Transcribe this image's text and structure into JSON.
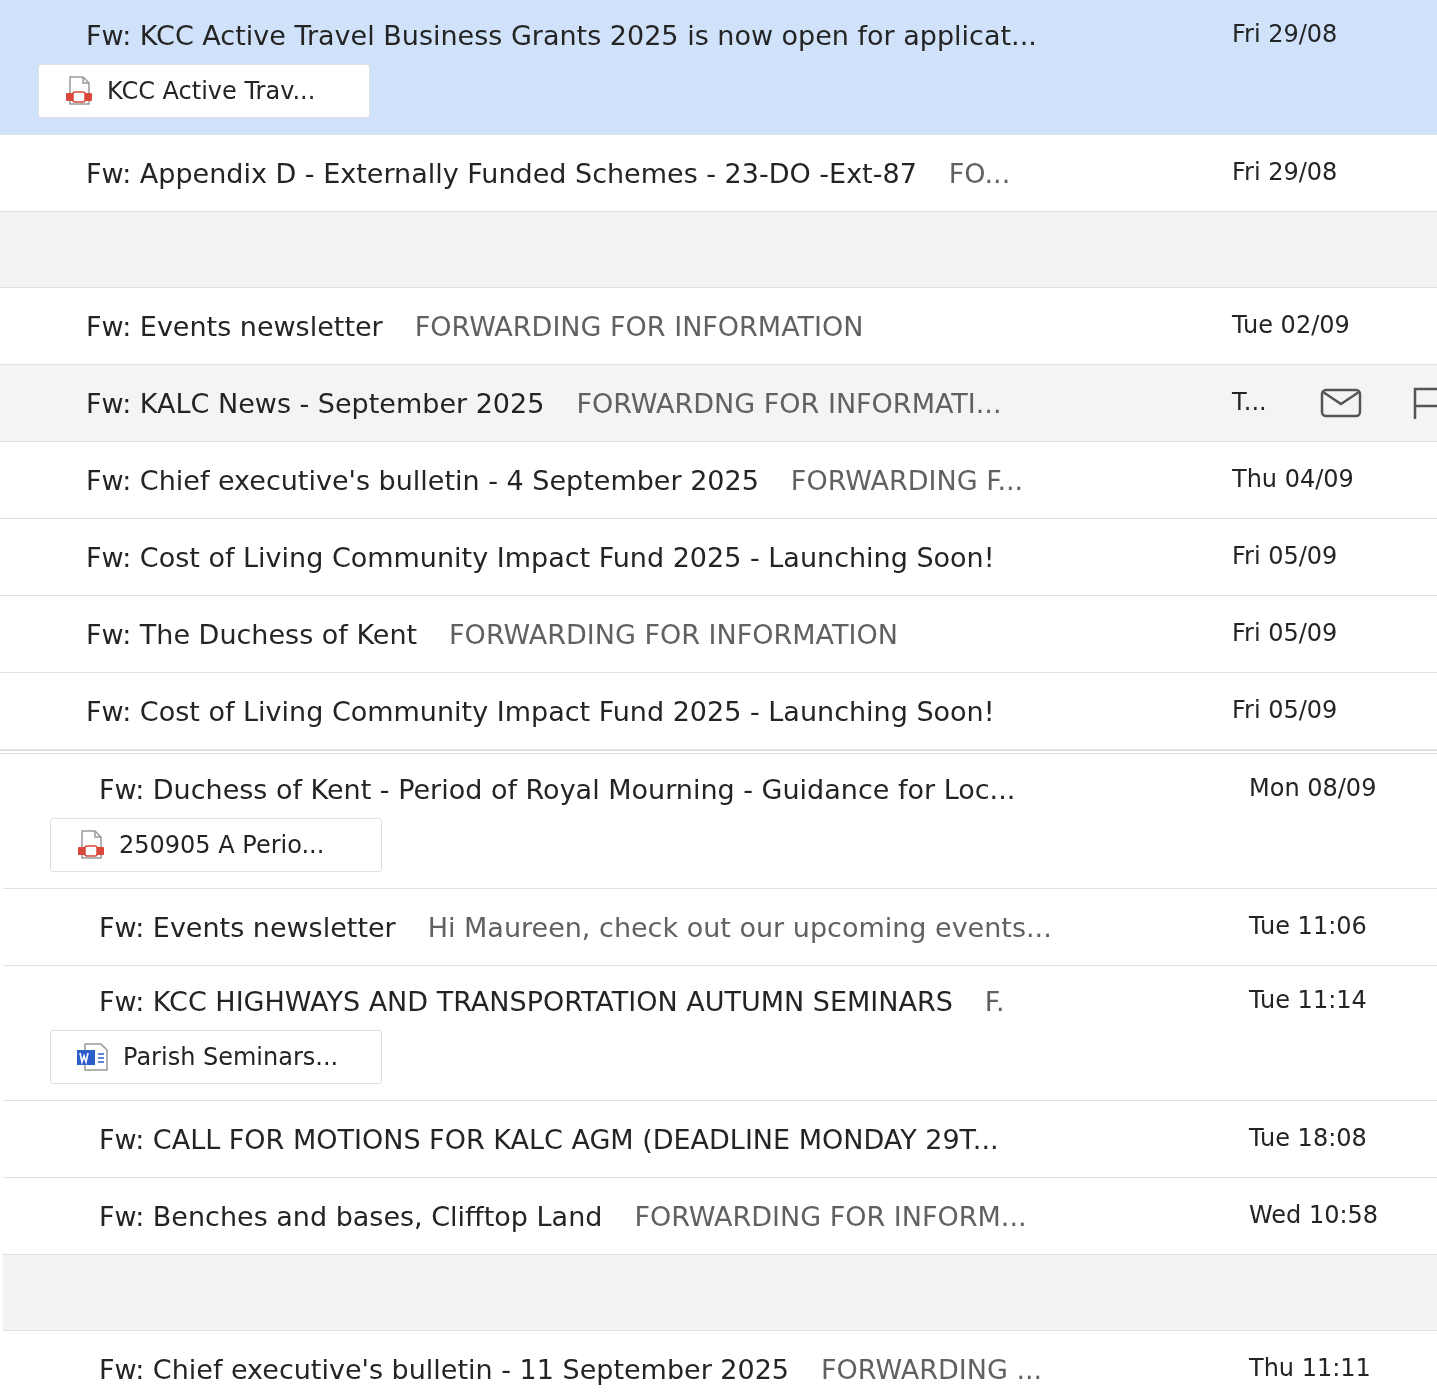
{
  "groups": [
    {
      "rows": [
        {
          "kind": "message",
          "subject": "Fw: KCC Active Travel Business Grants 2025 is now open for applicat...",
          "date": "Fri 29/08",
          "selected": true,
          "hovered": false,
          "attachment": {
            "kind": "pdf",
            "name": "KCC Active Trav..."
          }
        },
        {
          "kind": "message",
          "subject": "Fw: Appendix D - Externally Funded Schemes - 23-DO -Ext-87",
          "preview": "FO...",
          "date": "Fri 29/08",
          "selected": false,
          "hovered": false
        },
        {
          "kind": "blank"
        },
        {
          "kind": "message",
          "subject": "Fw: Events newsletter",
          "preview": "FORWARDING FOR INFORMATION",
          "date": "Tue 02/09",
          "selected": false,
          "hovered": false
        },
        {
          "kind": "message",
          "subject": "Fw: KALC News - September 2025",
          "preview": "FORWARDNG FOR INFORMATI...",
          "date": "T...",
          "selected": false,
          "hovered": true
        },
        {
          "kind": "message",
          "subject": "Fw: Chief executive's bulletin - 4 September 2025",
          "preview": "FORWARDING F...",
          "date": "Thu 04/09",
          "selected": false,
          "hovered": false
        },
        {
          "kind": "message",
          "subject": "Fw: Cost of Living Community Impact Fund 2025 - Launching Soon!",
          "date": "Fri 05/09",
          "selected": false,
          "hovered": false
        },
        {
          "kind": "message",
          "subject": "Fw: The Duchess of Kent",
          "preview": "FORWARDING FOR INFORMATION",
          "date": "Fri 05/09",
          "selected": false,
          "hovered": false
        },
        {
          "kind": "message",
          "subject": "Fw: Cost of Living Community Impact Fund 2025 - Launching Soon!",
          "date": "Fri 05/09",
          "selected": false,
          "hovered": false
        }
      ]
    },
    {
      "rows": [
        {
          "kind": "message",
          "subject": "Fw: Duchess of Kent - Period of Royal Mourning - Guidance for Loc...",
          "date": "Mon 08/09",
          "selected": false,
          "hovered": false,
          "attachment": {
            "kind": "pdf",
            "name": "250905 A Perio..."
          }
        },
        {
          "kind": "message",
          "subject": "Fw: Events newsletter",
          "preview": "Hi Maureen, check out our upcoming events...",
          "date": "Tue 11:06",
          "selected": false,
          "hovered": false
        },
        {
          "kind": "message",
          "subject": "Fw: KCC HIGHWAYS AND TRANSPORTATION AUTUMN SEMINARS",
          "preview": "F.",
          "date": "Tue 11:14",
          "selected": false,
          "hovered": false,
          "attachment": {
            "kind": "word",
            "name": "Parish Seminars..."
          }
        },
        {
          "kind": "message",
          "subject": "Fw: CALL FOR MOTIONS FOR KALC AGM (DEADLINE MONDAY 29T...",
          "date": "Tue 18:08",
          "selected": false,
          "hovered": false
        },
        {
          "kind": "message",
          "subject": "Fw: Benches and bases, Clifftop Land",
          "preview": "FORWARDING FOR INFORM...",
          "date": "Wed 10:58",
          "selected": false,
          "hovered": false
        },
        {
          "kind": "blank"
        },
        {
          "kind": "message",
          "subject": "Fw: Chief executive's bulletin - 11 September 2025",
          "preview": "FORWARDING ...",
          "date": "Thu 11:11",
          "selected": false,
          "hovered": false
        }
      ]
    }
  ]
}
